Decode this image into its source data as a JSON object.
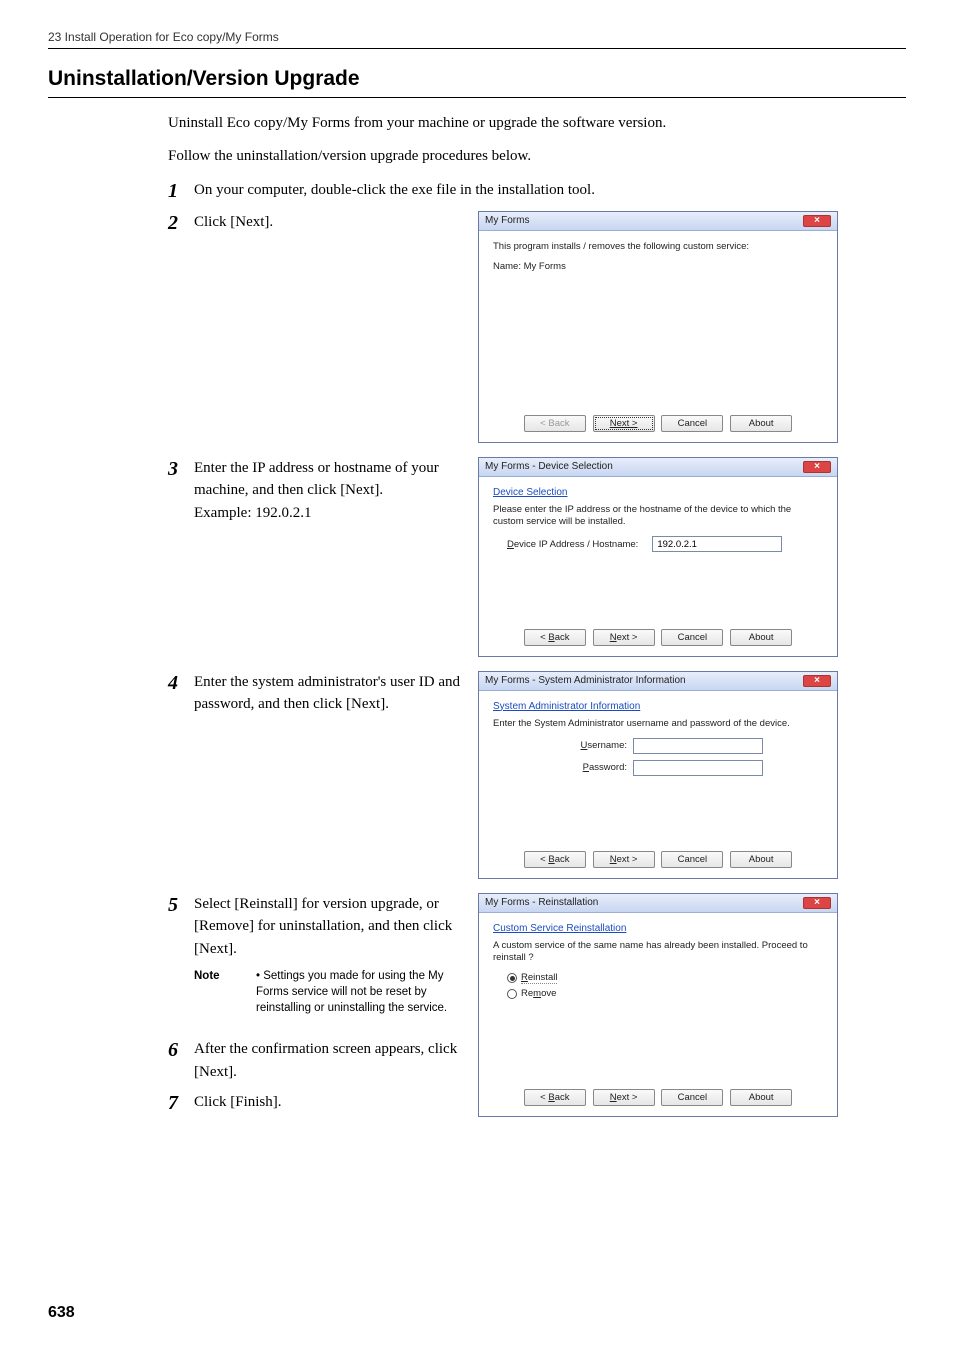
{
  "header": "23 Install Operation for Eco copy/My Forms",
  "section_title": "Uninstallation/Version Upgrade",
  "intro_1": "Uninstall Eco copy/My Forms from your machine or upgrade the software version.",
  "intro_2": "Follow the uninstallation/version upgrade procedures below.",
  "steps": {
    "s1": {
      "num": "1",
      "text": "On your computer, double-click the exe file in the installation tool."
    },
    "s2": {
      "num": "2",
      "text": "Click [Next]."
    },
    "s3": {
      "num": "3",
      "text_a": "Enter the IP address or hostname of your machine, and then click [Next].",
      "text_b": "Example: 192.0.2.1"
    },
    "s4": {
      "num": "4",
      "text": "Enter the system administrator's user ID and password, and then click [Next]."
    },
    "s5": {
      "num": "5",
      "text": "Select [Reinstall] for version upgrade, or [Remove] for uninstallation, and then click [Next]."
    },
    "s6": {
      "num": "6",
      "text": "After the confirmation screen appears, click [Next]."
    },
    "s7": {
      "num": "7",
      "text": "Click [Finish]."
    }
  },
  "note": {
    "label": "Note",
    "bullet": "•",
    "text": "Settings you made for using the My Forms service will not be reset by reinstalling or uninstalling the service."
  },
  "dlg1": {
    "title": "My Forms",
    "line1": "This program installs / removes the following custom service:",
    "line2": "Name: My Forms",
    "back": "< Back",
    "next": "Next >",
    "cancel": "Cancel",
    "about": "About"
  },
  "dlg2": {
    "title": "My Forms - Device Selection",
    "sub": "Device Selection",
    "line": "Please enter the IP address or the hostname of the device to which the custom service will be installed.",
    "lbl": "Device IP Address / Hostname:",
    "val": "192.0.2.1",
    "back": "< Back",
    "next": "Next >",
    "cancel": "Cancel",
    "about": "About"
  },
  "dlg3": {
    "title": "My Forms - System Administrator Information",
    "sub": "System Administrator Information",
    "line": "Enter the System Administrator username and password of the device.",
    "user_lbl": "Username:",
    "pass_lbl": "Password:",
    "back": "< Back",
    "next": "Next >",
    "cancel": "Cancel",
    "about": "About"
  },
  "dlg4": {
    "title": "My Forms - Reinstallation",
    "sub": "Custom Service Reinstallation",
    "line": "A custom service of the same name has already been installed. Proceed to reinstall ?",
    "opt1": "Reinstall",
    "opt2": "Remove",
    "back": "< Back",
    "next": "Next >",
    "cancel": "Cancel",
    "about": "About"
  },
  "page_num": "638"
}
